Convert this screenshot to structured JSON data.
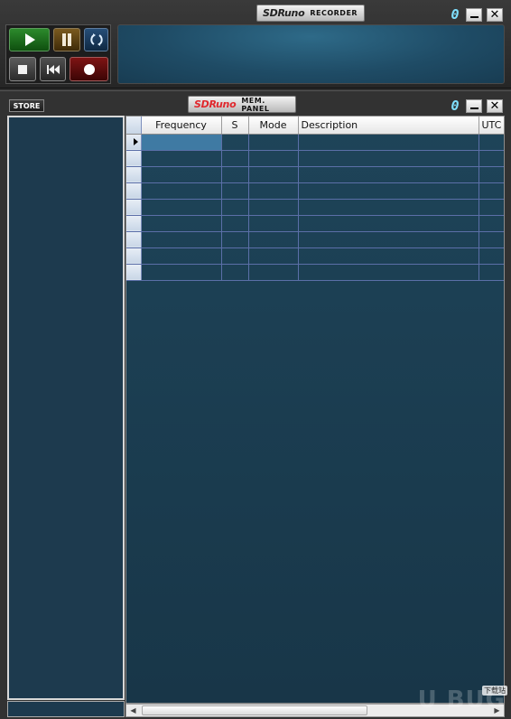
{
  "recorder": {
    "brand": "SDRuno",
    "title": "RECORDER",
    "digit": "0",
    "buttons": [
      "play-icon",
      "pause-icon",
      "loop-icon",
      "stop-icon",
      "rewind-icon",
      "record-icon"
    ]
  },
  "mem_panel": {
    "brand": "SDRuno",
    "title": "MEM. PANEL",
    "digit": "0",
    "store_label": "STORE",
    "columns": [
      "Frequency",
      "S",
      "Mode",
      "Description",
      "UTC"
    ],
    "row_count": 9,
    "selected_row": 0
  },
  "watermark": {
    "text": "U BUG",
    "sub": "下载站"
  },
  "colors": {
    "display_bg": "#1f4c66",
    "grid_bg": "#1e4459",
    "grid_lines": "#5b6fa8",
    "selected_cell": "#3f7aa3",
    "brand_red": "#e0282d",
    "segment_cyan": "#7fe0ff"
  }
}
